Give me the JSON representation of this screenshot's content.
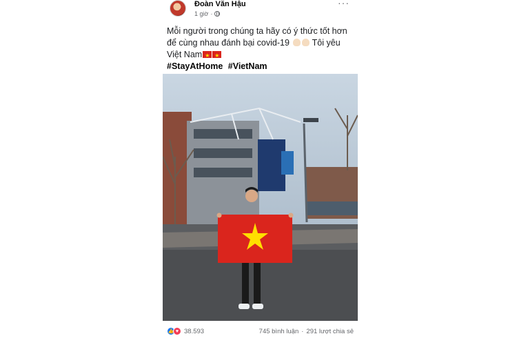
{
  "post": {
    "author": "Đoàn Văn Hậu",
    "time": "1 giờ",
    "separator": "·",
    "caption_line1": "Mỗi người trong chúng ta hãy có ý thức tốt hơn",
    "caption_line2": "để cùng nhau đánh bại covid-19",
    "caption_line3": "Tôi yêu",
    "caption_line4": "Việt Nam",
    "hashtags": [
      "#StayAtHome",
      "#VietNam"
    ]
  },
  "footer": {
    "reaction_count": "38.593",
    "comments": "745 bình luận",
    "dot": "·",
    "shares": "291 lượt chia sẻ"
  },
  "icons": {
    "more": "more-options-icon",
    "privacy": "globe-icon",
    "like": "like-icon",
    "love": "love-icon"
  },
  "colors": {
    "flag_red": "#da251d",
    "flag_star": "#ffde00",
    "like_blue": "#1877f2",
    "love_red": "#f33e58"
  }
}
